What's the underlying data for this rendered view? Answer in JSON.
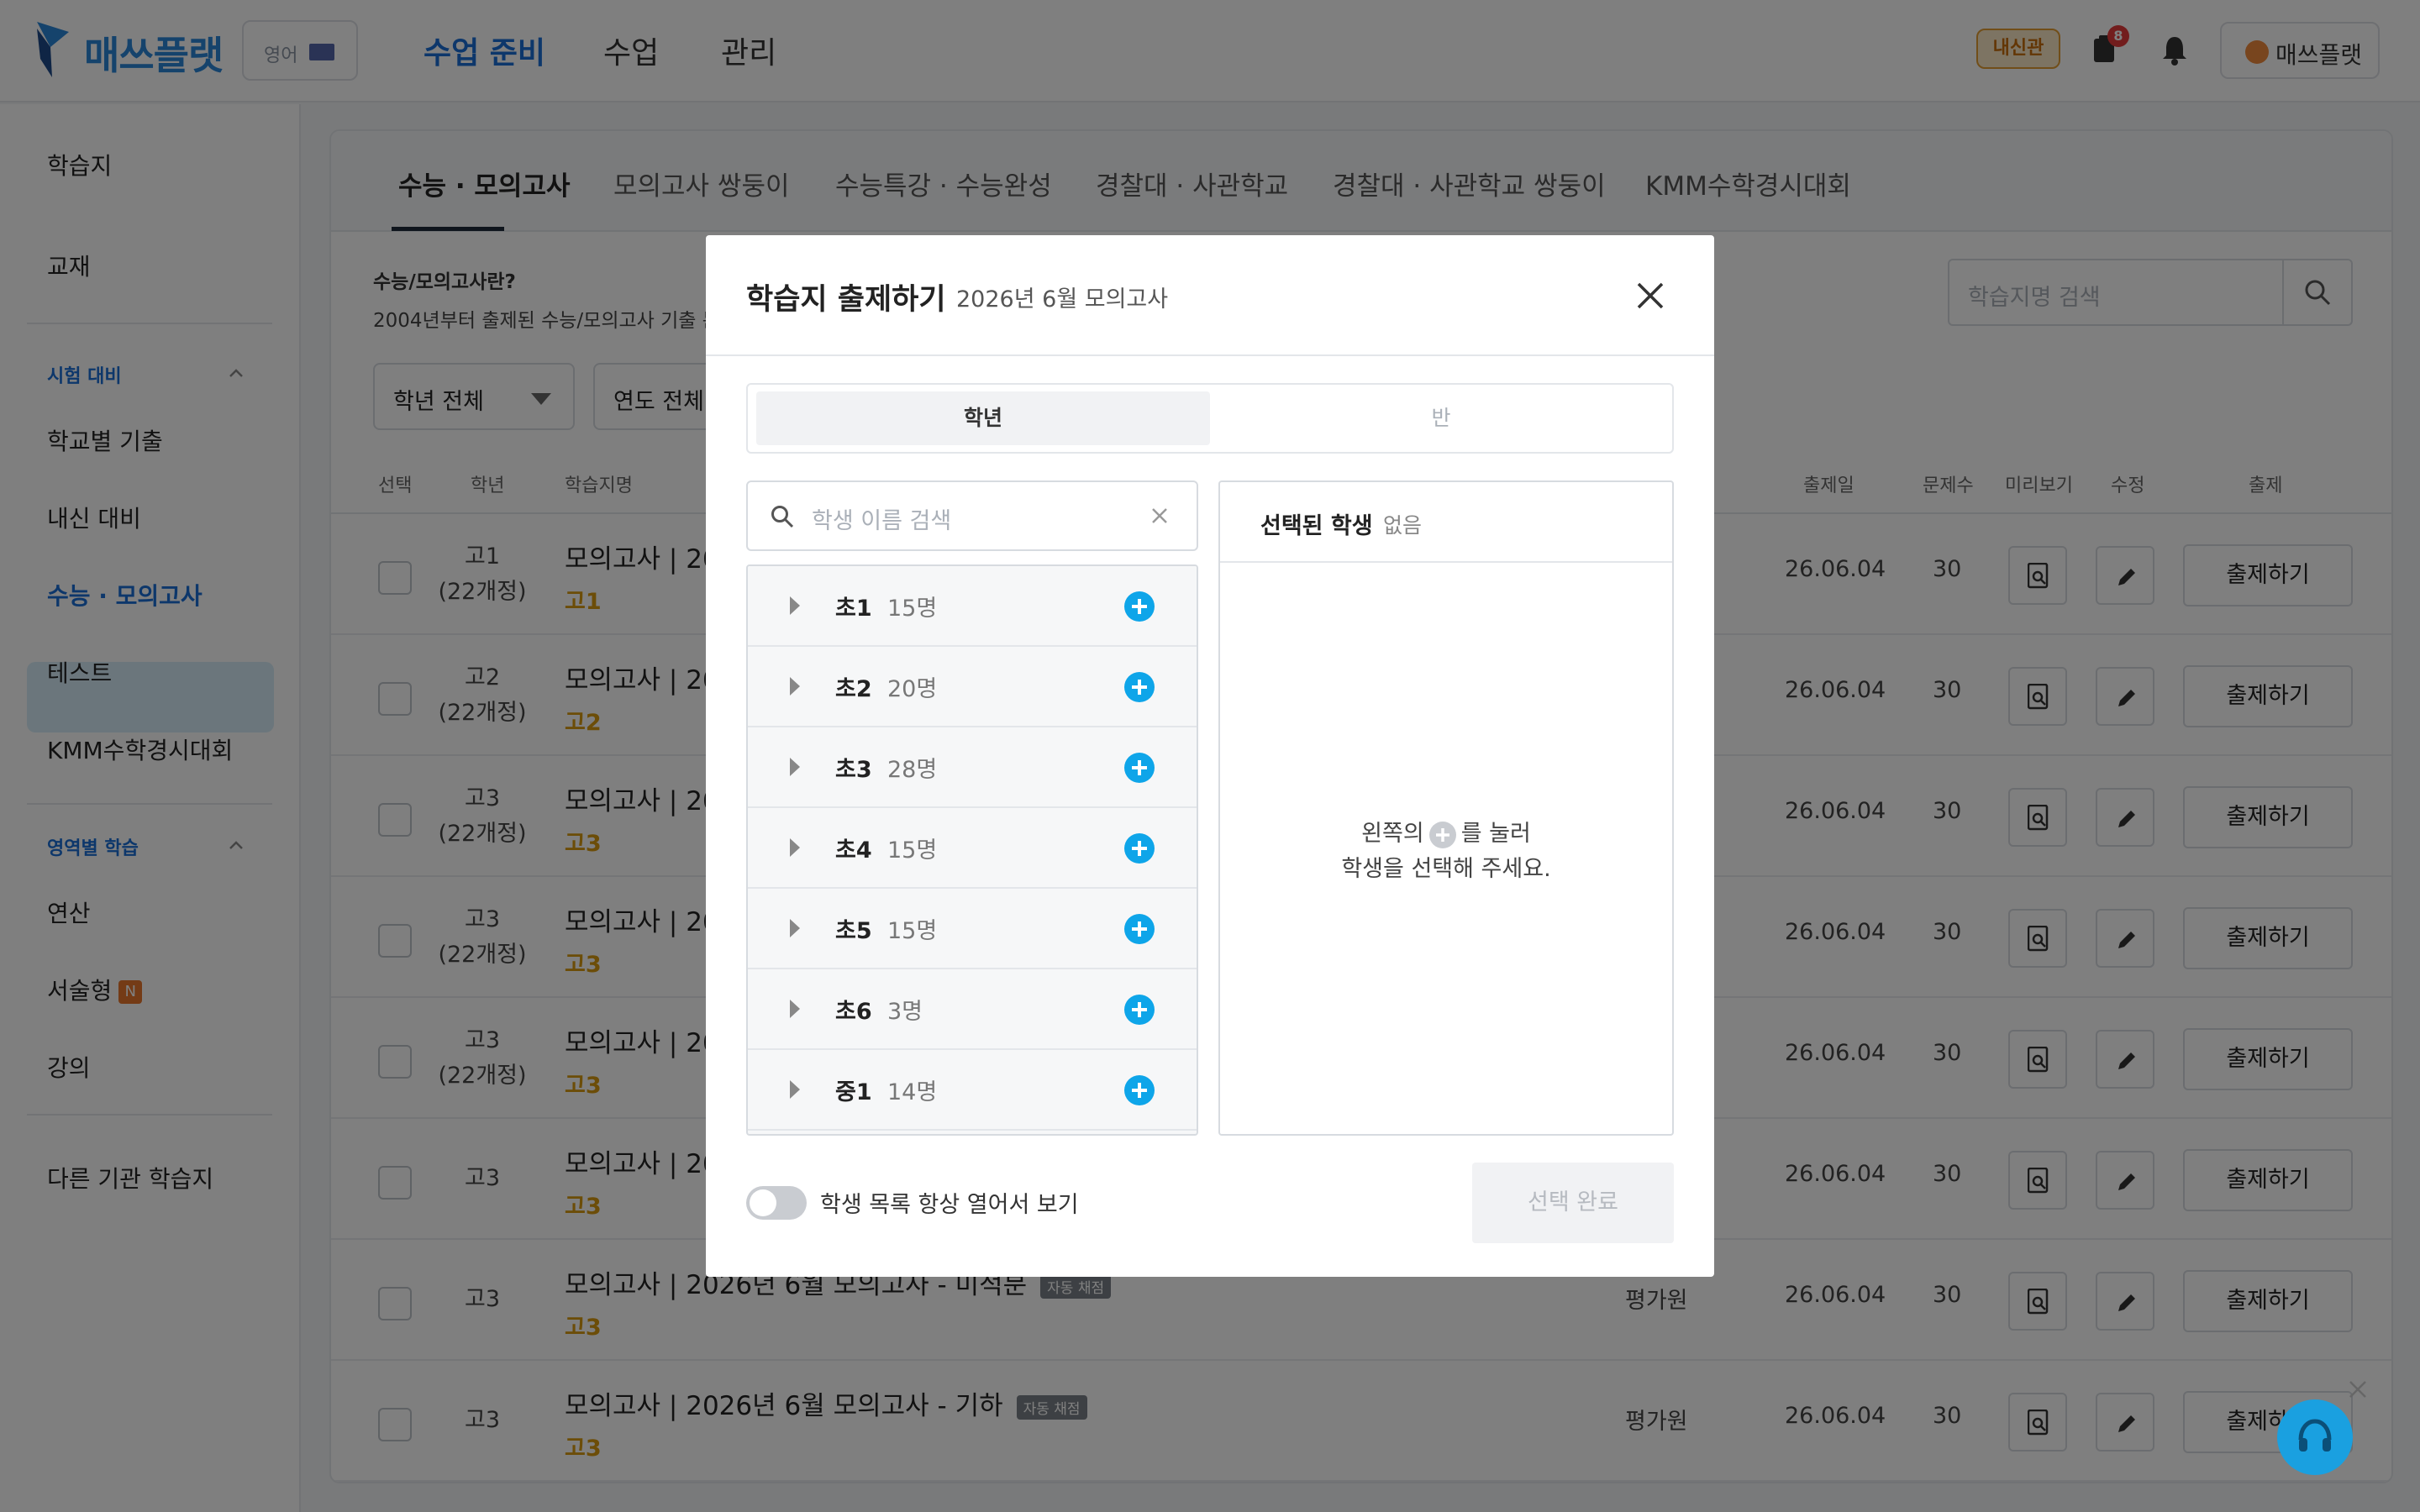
{
  "header": {
    "logo": "매쓰플랫",
    "lang": "영어",
    "nav": [
      "수업 준비",
      "수업",
      "관리"
    ],
    "naesin_badge": "내신관",
    "notif_count": "8",
    "user": "매쓰플랫"
  },
  "sidebar": {
    "items_top": [
      "학습지",
      "교재"
    ],
    "section1": "시험 대비",
    "section1_items": [
      "학교별 기출",
      "내신 대비",
      "수능 · 모의고사",
      "테스트",
      "KMM수학경시대회"
    ],
    "section2": "영역별 학습",
    "section2_items": [
      "연산",
      "서술형",
      "강의"
    ],
    "new_badge": "N",
    "bottom": "다른 기관 학습지"
  },
  "main": {
    "tabs": [
      "수능 · 모의고사",
      "모의고사 쌍둥이",
      "수능특강 · 수능완성",
      "경찰대 · 사관학교",
      "경찰대 · 사관학교 쌍둥이",
      "KMM수학경시대회"
    ],
    "desc_title": "수능/모의고사란?",
    "desc_text": "2004년부터 출제된 수능/모의고사 기출 문",
    "filter_grade": "학년 전체",
    "filter_year": "연도 전체",
    "search_placeholder": "학습지명 검색",
    "columns": {
      "select": "선택",
      "grade": "학년",
      "name": "학습지명",
      "date": "출제일",
      "count": "문제수",
      "preview": "미리보기",
      "edit": "수정",
      "assign": "출제"
    },
    "rows": [
      {
        "grade1": "고1",
        "grade2": "(22개정)",
        "title": "모의고사 | 20",
        "sub": "고1",
        "date": "26.06.04",
        "count": "30",
        "assign": "출제하기"
      },
      {
        "grade1": "고2",
        "grade2": "(22개정)",
        "title": "모의고사 | 20",
        "sub": "고2",
        "date": "26.06.04",
        "count": "30",
        "assign": "출제하기"
      },
      {
        "grade1": "고3",
        "grade2": "(22개정)",
        "title": "모의고사 | 20",
        "sub": "고3",
        "date": "26.06.04",
        "count": "30",
        "assign": "출제하기"
      },
      {
        "grade1": "고3",
        "grade2": "(22개정)",
        "title": "모의고사 | 20",
        "sub": "고3",
        "date": "26.06.04",
        "count": "30",
        "assign": "출제하기"
      },
      {
        "grade1": "고3",
        "grade2": "(22개정)",
        "title": "모의고사 | 20",
        "sub": "고3",
        "date": "26.06.04",
        "count": "30",
        "assign": "출제하기"
      },
      {
        "grade1": "고3",
        "grade2": "",
        "title": "모의고사 | 20",
        "sub": "고3",
        "date": "26.06.04",
        "count": "30",
        "assign": "출제하기"
      },
      {
        "grade1": "고3",
        "grade2": "",
        "title": "모의고사 | 2026년 6월 모의고사 - 미적분",
        "tag": "자동 채점",
        "sub": "고3",
        "org": "평가원",
        "date": "26.06.04",
        "count": "30",
        "assign": "출제하기"
      },
      {
        "grade1": "고3",
        "grade2": "",
        "title": "모의고사 | 2026년 6월 모의고사 - 기하",
        "tag": "자동 채점",
        "sub": "고3",
        "org": "평가원",
        "date": "26.06.04",
        "count": "30",
        "assign": "출제하기"
      }
    ]
  },
  "modal": {
    "title": "학습지 출제하기",
    "subtitle": "2026년 6월 모의고사",
    "seg_on": "학년",
    "seg_off": "반",
    "search_placeholder": "학생 이름 검색",
    "groups": [
      {
        "name": "초1",
        "count": "15명"
      },
      {
        "name": "초2",
        "count": "20명"
      },
      {
        "name": "초3",
        "count": "28명"
      },
      {
        "name": "초4",
        "count": "15명"
      },
      {
        "name": "초5",
        "count": "15명"
      },
      {
        "name": "초6",
        "count": "3명"
      },
      {
        "name": "중1",
        "count": "14명"
      }
    ],
    "selected_title": "선택된 학생",
    "selected_none": "없음",
    "hint1a": "왼쪽의",
    "hint1b": "를 눌러",
    "hint2": "학생을 선택해 주세요.",
    "toggle_label": "학생 목록 항상 열어서 보기",
    "toggle_on": false,
    "done": "선택 완료"
  },
  "colors": {
    "accent": "#1a6fd6",
    "plus": "#0ea5e9",
    "grade_sub": "#d89a10"
  }
}
